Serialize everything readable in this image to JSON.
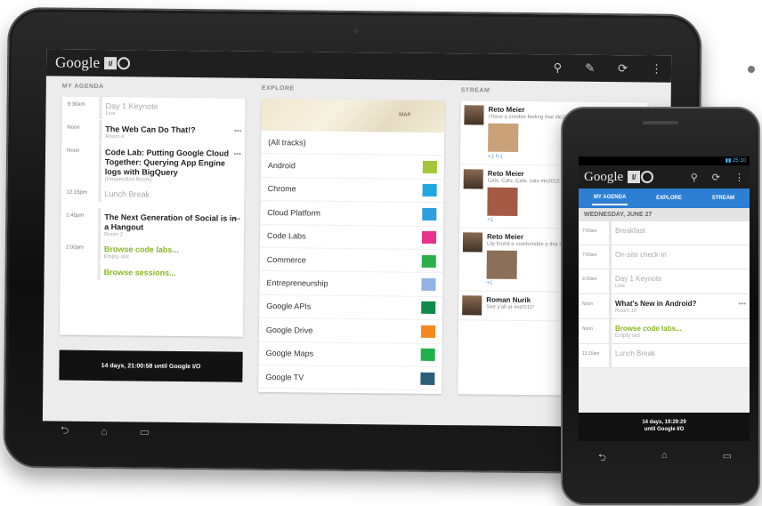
{
  "tablet": {
    "logo": "Google",
    "io_i": "I/",
    "actions": [
      "⚲",
      "✎",
      "⟳",
      "⋮"
    ],
    "columns": {
      "agenda_title": "MY AGENDA",
      "explore_title": "EXPLORE",
      "stream_title": "STREAM"
    },
    "agenda": [
      {
        "time": "9:30am",
        "title": "Day 1 Keynote",
        "sub": "Live",
        "style": "muted",
        "more": ""
      },
      {
        "time": "Noon",
        "title": "The Web Can Do That!?",
        "sub": "Room 4",
        "style": "",
        "more": "•••"
      },
      {
        "time": "Noon",
        "title": "Code Lab: Putting Google Cloud Together: Querying App Engine logs with BigQuery",
        "sub": "(Unspecified Room)",
        "style": "",
        "more": "•••"
      },
      {
        "time": "12:15pm",
        "title": "Lunch Break",
        "sub": "",
        "style": "muted",
        "more": ""
      },
      {
        "time": "1:45pm",
        "title": "The Next Generation of Social is in a Hangout",
        "sub": "Room 2",
        "style": "",
        "more": "•••"
      },
      {
        "time": "2:00pm",
        "title": "Browse code labs...",
        "sub": "Empty slot",
        "style": "green",
        "more": ""
      },
      {
        "time": "",
        "title": "Browse sessions...",
        "sub": "",
        "style": "green",
        "more": ""
      }
    ],
    "countdown": "14 days, 21:00:58 until Google I/O",
    "map_label": "MAP",
    "tracks": [
      {
        "label": "(All tracks)",
        "color": ""
      },
      {
        "label": "Android",
        "color": "#a4c639"
      },
      {
        "label": "Chrome",
        "color": "#20a8e0"
      },
      {
        "label": "Cloud Platform",
        "color": "#2f9ee0"
      },
      {
        "label": "Code Labs",
        "color": "#e8318a"
      },
      {
        "label": "Commerce",
        "color": "#2cb04a"
      },
      {
        "label": "Entrepreneurship",
        "color": "#8fb4e3"
      },
      {
        "label": "Google APIs",
        "color": "#0f8a4a"
      },
      {
        "label": "Google Drive",
        "color": "#f5891f"
      },
      {
        "label": "Google Maps",
        "color": "#22b14c"
      },
      {
        "label": "Google TV",
        "color": "#2d5f7a"
      }
    ],
    "stream": [
      {
        "name": "Reto Meier",
        "text": "I have a zombie feeling that #io2012",
        "photo": "#c9a27a",
        "meta": "+1  ↻1"
      },
      {
        "name": "Reto Meier",
        "text": "Cats. Cats. Cats. cats #io2012",
        "photo": "#a45a44",
        "meta": "+1"
      },
      {
        "name": "Reto Meier",
        "text": "Lily found a comfortable p this morning. #Caturday",
        "photo": "#8c6f58",
        "meta": "+1"
      },
      {
        "name": "Roman Nurik",
        "text": "See y'all at #io2012!",
        "photo": "",
        "meta": ""
      }
    ],
    "nav": [
      "⮌",
      "⌂",
      "▭"
    ]
  },
  "phone": {
    "status": "▮▮ 25:10",
    "logo": "Google",
    "io_i": "I/",
    "actions": [
      "⚲",
      "⟳",
      "⋮"
    ],
    "tabs": [
      {
        "label": "MY AGENDA",
        "active": true
      },
      {
        "label": "EXPLORE",
        "active": false
      },
      {
        "label": "STREAM",
        "active": false
      }
    ],
    "day": "WEDNESDAY, JUNE 27",
    "rows": [
      {
        "time": "7:00am",
        "title": "Breakfast",
        "sub": "",
        "style": "muted",
        "more": ""
      },
      {
        "time": "7:00am",
        "title": "On-site check-in",
        "sub": "",
        "style": "muted",
        "more": ""
      },
      {
        "time": "9:30am",
        "title": "Day 1 Keynote",
        "sub": "Live",
        "style": "muted",
        "more": ""
      },
      {
        "time": "Noon",
        "title": "What's New in Android?",
        "sub": "Room 10",
        "style": "",
        "more": "•••"
      },
      {
        "time": "Noon",
        "title": "Browse code labs...",
        "sub": "Empty slot",
        "style": "green",
        "more": ""
      },
      {
        "time": "12:15am",
        "title": "Lunch Break",
        "sub": "",
        "style": "muted",
        "more": ""
      }
    ],
    "countdown_line1": "14 days, 19:29:29",
    "countdown_line2": "until Google I/O",
    "nav": [
      "⮌",
      "⌂",
      "▭"
    ]
  }
}
